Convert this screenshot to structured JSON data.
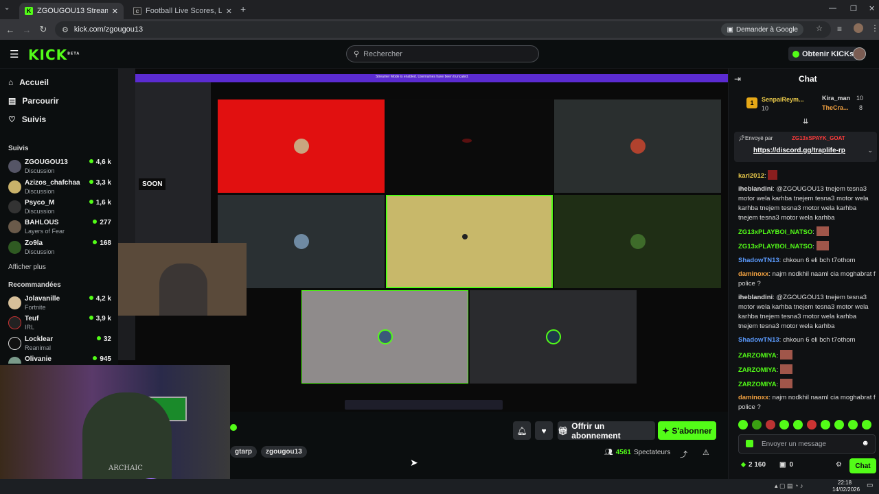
{
  "browser": {
    "tabs": [
      {
        "title": "ZGOUGOU13 Stream - Watch...",
        "active": true
      },
      {
        "title": "Football Live Scores, Latest Foot",
        "active": false
      }
    ],
    "url": "kick.com/zgougou13",
    "google_button": "Demander à Google"
  },
  "header": {
    "logo": "KICK",
    "logo_beta": "BETA",
    "search_placeholder": "Rechercher",
    "kicks_button": "Obtenir KICKs"
  },
  "sidebar": {
    "nav": [
      {
        "label": "Accueil",
        "icon": "home-icon"
      },
      {
        "label": "Parcourir",
        "icon": "browse-icon"
      },
      {
        "label": "Suivis",
        "icon": "heart-icon"
      }
    ],
    "followed_title": "Suivis",
    "followed": [
      {
        "name": "ZGOUGOU13",
        "category": "Discussion",
        "viewers": "4,6 k"
      },
      {
        "name": "Azizos_chafchaa",
        "category": "Discussion",
        "viewers": "3,3 k"
      },
      {
        "name": "Psyco_M",
        "category": "Discussion",
        "viewers": "1,6 k"
      },
      {
        "name": "BAHLOUS",
        "category": "Layers of Fear",
        "viewers": "277"
      },
      {
        "name": "Zo9la",
        "category": "Discussion",
        "viewers": "168"
      }
    ],
    "show_more": "Afficher plus",
    "recommended_title": "Recommandées",
    "recommended": [
      {
        "name": "Jolavanille",
        "category": "Fortnite",
        "viewers": "4,2 k"
      },
      {
        "name": "Teuf",
        "category": "IRL",
        "viewers": "3,9 k"
      },
      {
        "name": "Locklear",
        "category": "Reanimal",
        "viewers": "32"
      },
      {
        "name": "Olivanie",
        "category": "",
        "viewers": "945"
      }
    ]
  },
  "video": {
    "discord_banner": "Streamer Mode is enabled. Usernames have been truncated.",
    "soon_label": "SOON",
    "tile_colors": [
      "#e11010",
      "#0b0b0b",
      "#2a2f2f",
      "#2a3033",
      "#c8b86a",
      "#1f2e15",
      "#8f8b8b",
      "#2a2b2e"
    ],
    "webcam_overlay": "ARCHAIC"
  },
  "below": {
    "tags": [
      "gtarp",
      "zgougou13"
    ],
    "offrir_label": "Offrir un abonnement",
    "subscribe_label": "S'abonner",
    "viewers_count": "4561",
    "viewers_label": "Spectateurs"
  },
  "chat": {
    "title": "Chat",
    "top_gifters": [
      {
        "rank": "1",
        "name": "SenpaiReym...",
        "count": "10"
      },
      {
        "name": "Kira_man",
        "count": "10"
      },
      {
        "name": "TheCra...",
        "count": "8"
      }
    ],
    "pinned": {
      "label": "Envoyé par",
      "user": "ZG13xSPAYK_GOAT",
      "link": "https://discord.gg/traplife-rp"
    },
    "messages": [
      {
        "user": "kari2012",
        "color": "#e9c94a",
        "text": ""
      },
      {
        "user": "iheblandini",
        "color": "#e0e0e0",
        "text": "@ZGOUGOU13 tnejem tesna3 motor wela karhba tnejem tesna3 motor wela karhba tnejem tesna3 motor wela karhba tnejem tesna3 motor wela karhba"
      },
      {
        "user": "ZG13xPLAYBOI_NATSO",
        "color": "#53fc18",
        "text": ""
      },
      {
        "user": "ZG13xPLAYBOI_NATSO",
        "color": "#53fc18",
        "text": ""
      },
      {
        "user": "ShadowTN13",
        "color": "#5b9bff",
        "text": "chkoun 6 eli bch t7othom"
      },
      {
        "user": "daminoxx",
        "color": "#f0a040",
        "text": "najm nodkhil naaml cia moghabrat f police ?"
      },
      {
        "user": "iheblandini",
        "color": "#e0e0e0",
        "text": "@ZGOUGOU13 tnejem tesna3 motor wela karhba tnejem tesna3 motor wela karhba tnejem tesna3 motor wela karhba tnejem tesna3 motor wela karhba"
      },
      {
        "user": "ShadowTN13",
        "color": "#5b9bff",
        "text": "chkoun 6 eli bch t7othom"
      },
      {
        "user": "ZARZOMIYA",
        "color": "#53fc18",
        "text": ""
      },
      {
        "user": "ZARZOMIYA",
        "color": "#53fc18",
        "text": ""
      },
      {
        "user": "ZARZOMIYA",
        "color": "#53fc18",
        "text": ""
      },
      {
        "user": "daminoxx",
        "color": "#f0a040",
        "text": "najm nodkhil naaml cia moghabrat f police ?"
      }
    ],
    "input_placeholder": "Envoyer un message",
    "kicks_count": "2 160",
    "bag_count": "0",
    "send_label": "Chat"
  },
  "taskbar": {
    "time": "22:18",
    "date": "14/02/2026"
  }
}
